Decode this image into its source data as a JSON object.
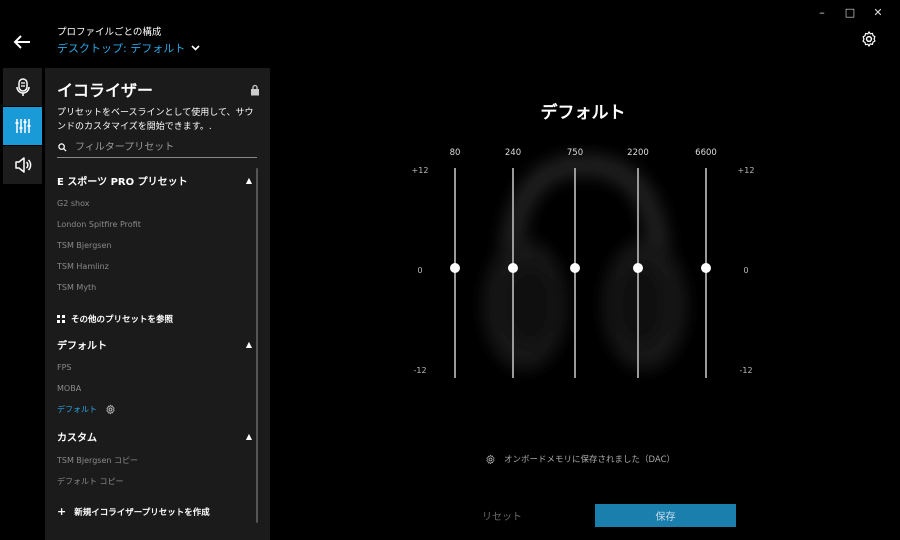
{
  "window": {
    "minimize": "–",
    "maximize": "□",
    "close": "✕"
  },
  "header": {
    "caption": "プロファイルごとの構成",
    "profile": "デスクトップ: デフォルト"
  },
  "panel": {
    "title": "イコライザー",
    "description": "プリセットをベースラインとして使用して、サウンドのカスタマイズを開始できます。.",
    "search_placeholder": "フィルタープリセット",
    "sections": [
      {
        "title": "E スポーツ PRO プリセット",
        "items": [
          "G2 shox",
          "London Spitfire Profit",
          "TSM Bjergsen",
          "TSM Hamlinz",
          "TSM Myth"
        ]
      },
      {
        "title": "デフォルト",
        "items": [
          "FPS",
          "MOBA",
          "デフォルト"
        ]
      },
      {
        "title": "カスタム",
        "items": [
          "TSM Bjergsen コピー",
          "デフォルト コピー"
        ]
      }
    ],
    "browse_label": "その他のプリセットを参照",
    "create_label": "新規イコライザープリセットを作成"
  },
  "equalizer": {
    "title": "デフォルト",
    "bands": [
      {
        "freq": "80",
        "gain": 0
      },
      {
        "freq": "240",
        "gain": 0
      },
      {
        "freq": "750",
        "gain": 0
      },
      {
        "freq": "2200",
        "gain": 0
      },
      {
        "freq": "6600",
        "gain": 0
      }
    ],
    "db_top": "+12",
    "db_mid": "0",
    "db_bottom": "-12",
    "status": "オンボードメモリに保存されました（DAC）",
    "reset_label": "リセット",
    "save_label": "保存"
  },
  "colors": {
    "accent": "#1a9ad6",
    "save": "#1a7fad",
    "panel": "#1b1b1b"
  }
}
